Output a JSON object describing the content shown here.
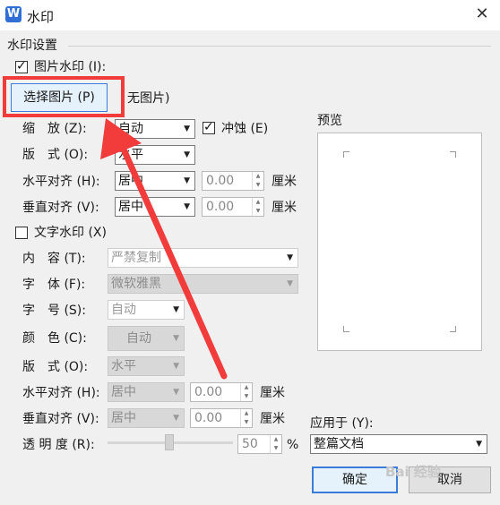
{
  "window": {
    "title": "水印",
    "app_icon_letter": "W",
    "close_glyph": "✕"
  },
  "section_title": "水印设置",
  "image_watermark": {
    "checkbox_label": "图片水印 (I):",
    "choose_button": "选择图片 (P)",
    "no_image": "无图片)",
    "scale_label": "缩　放 (Z):",
    "scale_value": "自动",
    "washout_label": "冲蚀 (E)",
    "layout_label": "版　式 (O):",
    "layout_value": "水平",
    "halign_label": "水平对齐 (H):",
    "halign_value": "居中",
    "halign_offset": "0.00",
    "valign_label": "垂直对齐 (V):",
    "valign_value": "居中",
    "valign_offset": "0.00",
    "unit": "厘米"
  },
  "text_watermark": {
    "checkbox_label": "文字水印 (X)",
    "content_label": "内　容 (T):",
    "content_value": "严禁复制",
    "font_label": "字　体 (F):",
    "font_value": "微软雅黑",
    "size_label": "字　号 (S):",
    "size_value": "自动",
    "color_label": "颜　色 (C):",
    "color_value": "自动",
    "layout_label": "版　式 (O):",
    "layout_value": "水平",
    "halign_label": "水平对齐 (H):",
    "halign_value": "居中",
    "halign_offset": "0.00",
    "valign_label": "垂直对齐 (V):",
    "valign_value": "居中",
    "valign_offset": "0.00",
    "unit": "厘米",
    "transparency_label": "透 明 度 (R):",
    "transparency_value": "50",
    "transparency_unit": "%"
  },
  "preview": {
    "label": "预览"
  },
  "apply_to": {
    "label": "应用于 (Y):",
    "value": "整篇文档"
  },
  "buttons": {
    "ok": "确定",
    "cancel": "取消"
  },
  "watermark_text": "Bai 经验",
  "colors": {
    "highlight_red": "#f23b3b",
    "accent_blue": "#3b7cd8"
  }
}
